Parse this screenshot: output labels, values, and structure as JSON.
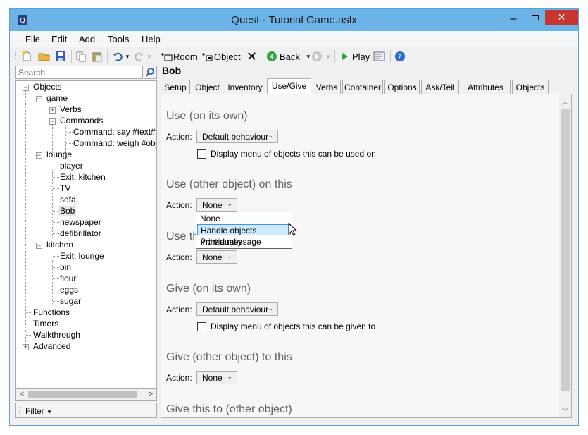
{
  "window": {
    "title": "Quest - Tutorial Game.aslx",
    "minimize": "–",
    "close": "✕"
  },
  "menu": [
    "File",
    "Edit",
    "Add",
    "Tools",
    "Help"
  ],
  "toolbar": {
    "room": "Room",
    "object": "Object",
    "back": "Back",
    "play": "Play"
  },
  "search": {
    "placeholder": "Search"
  },
  "tree": {
    "objects": "Objects",
    "game": "game",
    "verbs": "Verbs",
    "commands": "Commands",
    "cmd1": "Command: say #text#",
    "cmd2": "Command: weigh #object#",
    "lounge": "lounge",
    "player": "player",
    "exit_kitchen": "Exit: kitchen",
    "tv": "TV",
    "sofa": "sofa",
    "bob": "Bob",
    "newspaper": "newspaper",
    "defibrillator": "defibrillator",
    "kitchen": "kitchen",
    "exit_lounge": "Exit: lounge",
    "bin": "bin",
    "flour": "flour",
    "eggs": "eggs",
    "sugar": "sugar",
    "functions": "Functions",
    "timers": "Timers",
    "walkthrough": "Walkthrough",
    "advanced": "Advanced"
  },
  "filter": {
    "label": "Filter"
  },
  "editor": {
    "object_name": "Bob",
    "tabs": [
      "Setup",
      "Object",
      "Inventory",
      "Use/Give",
      "Verbs",
      "Container",
      "Options",
      "Ask/Tell",
      "Attributes",
      "Objects"
    ],
    "active_tab": "Use/Give",
    "action_label": "Action:",
    "sections": {
      "use_own": "Use (on its own)",
      "use_own_value": "Default behaviour",
      "use_own_check": "Display menu of objects this can be used on",
      "use_other": "Use (other object) on this",
      "use_other_value": "None",
      "use_this": "Use this on (other object)",
      "use_this_value": "None",
      "give_own": "Give (on its own)",
      "give_own_value": "Default behaviour",
      "give_own_check": "Display menu of objects this can be given to",
      "give_other": "Give (other object) to this",
      "give_other_value": "None",
      "give_this": "Give this to (other object)"
    },
    "dropdown_options": [
      "None",
      "Handle objects individually",
      "Print a message"
    ],
    "highlighted_option": "Handle objects individually"
  }
}
